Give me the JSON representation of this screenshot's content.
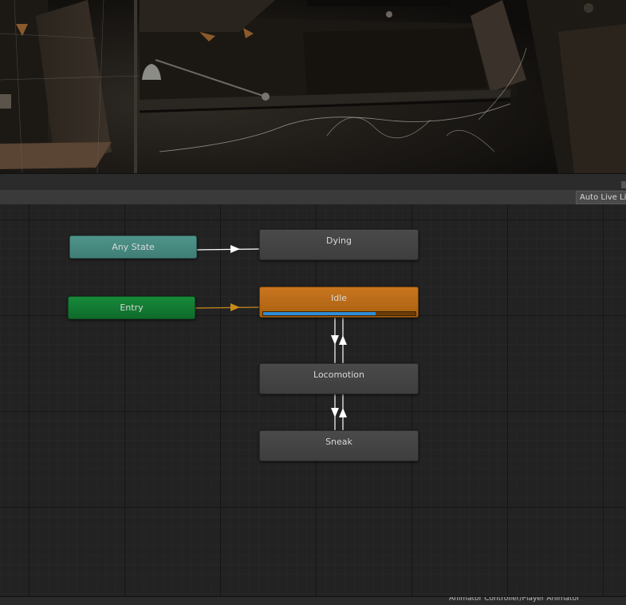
{
  "toolbar": {
    "live_link_label": "Auto Live Link"
  },
  "graph": {
    "states": {
      "any_state": "Any State",
      "entry": "Entry",
      "dying": "Dying",
      "idle": "Idle",
      "locomotion": "Locomotion",
      "sneak": "Sneak"
    },
    "idle_progress": 0.74
  },
  "status_bar": {
    "text": "Animator Controller/Player Animator"
  },
  "colors": {
    "any_state": "#4f948a",
    "entry": "#168a3a",
    "default_state": "#c9751f",
    "state": "#434343",
    "progress": "#2f8fd8",
    "transition": "#ffffff",
    "entry_transition": "#c98a1a"
  }
}
